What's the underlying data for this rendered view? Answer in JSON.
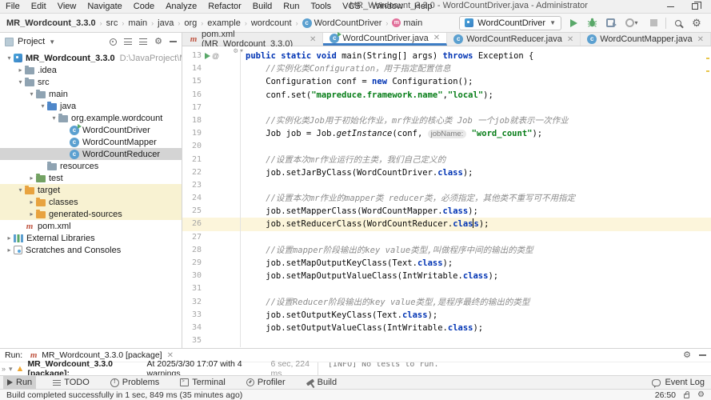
{
  "window": {
    "title": "MR_Wordcount_3.3.0 - WordCountDriver.java - Administrator"
  },
  "menu": {
    "items": [
      "File",
      "Edit",
      "View",
      "Navigate",
      "Code",
      "Analyze",
      "Refactor",
      "Build",
      "Run",
      "Tools",
      "VCS",
      "Window",
      "Help"
    ]
  },
  "navbar": {
    "breadcrumbs": [
      {
        "label": "MR_Wordcount_3.3.0",
        "bold": true
      },
      {
        "label": "src"
      },
      {
        "label": "main"
      },
      {
        "label": "java"
      },
      {
        "label": "org"
      },
      {
        "label": "example"
      },
      {
        "label": "wordcount"
      },
      {
        "label": "WordCountDriver",
        "icon": "class"
      },
      {
        "label": "main",
        "icon": "method"
      }
    ],
    "run_config": "WordCountDriver"
  },
  "project": {
    "header": "Project",
    "tree": [
      {
        "label": "MR_Wordcount_3.3.0",
        "path": "D:\\JavaProject\\MR_Worc",
        "level": 0,
        "chevron": "down",
        "icon": "project",
        "bold": true
      },
      {
        "label": ".idea",
        "level": 1,
        "chevron": "right",
        "icon": "folder"
      },
      {
        "label": "src",
        "level": 1,
        "chevron": "down",
        "icon": "folder"
      },
      {
        "label": "main",
        "level": 2,
        "chevron": "down",
        "icon": "folder"
      },
      {
        "label": "java",
        "level": 3,
        "chevron": "down",
        "icon": "folder-src"
      },
      {
        "label": "org.example.wordcount",
        "level": 4,
        "chevron": "down",
        "icon": "package"
      },
      {
        "label": "WordCountDriver",
        "level": 5,
        "chevron": "none",
        "icon": "class-run"
      },
      {
        "label": "WordCountMapper",
        "level": 5,
        "chevron": "none",
        "icon": "class"
      },
      {
        "label": "WordCountReducer",
        "level": 5,
        "chevron": "none",
        "icon": "class",
        "selected": true
      },
      {
        "label": "resources",
        "level": 3,
        "chevron": "none",
        "icon": "folder"
      },
      {
        "label": "test",
        "level": 2,
        "chevron": "right",
        "icon": "folder-test"
      },
      {
        "label": "target",
        "level": 1,
        "chevron": "down",
        "icon": "folder-excluded",
        "highlight": true
      },
      {
        "label": "classes",
        "level": 2,
        "chevron": "right",
        "icon": "folder-excluded",
        "highlight": true
      },
      {
        "label": "generated-sources",
        "level": 2,
        "chevron": "right",
        "icon": "folder-excluded",
        "highlight": true
      },
      {
        "label": "pom.xml",
        "level": 1,
        "chevron": "none",
        "icon": "maven"
      },
      {
        "label": "External Libraries",
        "level": 0,
        "chevron": "right",
        "icon": "libs"
      },
      {
        "label": "Scratches and Consoles",
        "level": 0,
        "chevron": "right",
        "icon": "scratches"
      }
    ]
  },
  "tabs": [
    {
      "label": "pom.xml (MR_Wordcount_3.3.0)",
      "icon": "maven"
    },
    {
      "label": "WordCountDriver.java",
      "icon": "class-run",
      "active": true
    },
    {
      "label": "WordCountReducer.java",
      "icon": "class"
    },
    {
      "label": "WordCountMapper.java",
      "icon": "class"
    }
  ],
  "editor": {
    "lines": [
      {
        "n": 13,
        "gutter": "run",
        "segs": [
          {
            "t": "public static void ",
            "c": "kw"
          },
          {
            "t": "main(String[] args) ",
            "c": "plain"
          },
          {
            "t": "throws ",
            "c": "kw"
          },
          {
            "t": "Exception {",
            "c": "plain"
          }
        ]
      },
      {
        "n": 14,
        "segs": [
          {
            "t": "    //实例化类Configuration，用于指定配置信息",
            "c": "com"
          }
        ]
      },
      {
        "n": 15,
        "segs": [
          {
            "t": "    Configuration conf = ",
            "c": "plain"
          },
          {
            "t": "new",
            "c": "kw"
          },
          {
            "t": " Configuration();",
            "c": "plain"
          }
        ]
      },
      {
        "n": 16,
        "segs": [
          {
            "t": "    conf.set(",
            "c": "plain"
          },
          {
            "t": "\"mapreduce.framework.name\"",
            "c": "str"
          },
          {
            "t": ",",
            "c": "plain"
          },
          {
            "t": "\"local\"",
            "c": "str"
          },
          {
            "t": ");",
            "c": "plain"
          }
        ]
      },
      {
        "n": 17,
        "segs": []
      },
      {
        "n": 18,
        "segs": [
          {
            "t": "    //实例化类Job用于初始化作业，mr作业的核心类 Job 一个job就表示一次作业",
            "c": "com"
          }
        ]
      },
      {
        "n": 19,
        "segs": [
          {
            "t": "    Job job = Job.",
            "c": "plain"
          },
          {
            "t": "getInstance",
            "c": "staticm"
          },
          {
            "t": "(conf, ",
            "c": "plain"
          },
          {
            "t": "jobName:",
            "c": "hint"
          },
          {
            "t": " ",
            "c": "plain"
          },
          {
            "t": "\"word_count\"",
            "c": "str"
          },
          {
            "t": ");",
            "c": "plain"
          }
        ]
      },
      {
        "n": 20,
        "segs": []
      },
      {
        "n": 21,
        "segs": [
          {
            "t": "    //设置本次mr作业运行的主类，我们自己定义的",
            "c": "com"
          }
        ]
      },
      {
        "n": 22,
        "segs": [
          {
            "t": "    job.setJarByClass(WordCountDriver.",
            "c": "plain"
          },
          {
            "t": "class",
            "c": "kw"
          },
          {
            "t": ");",
            "c": "plain"
          }
        ]
      },
      {
        "n": 23,
        "segs": []
      },
      {
        "n": 24,
        "segs": [
          {
            "t": "    //设置本次mr作业的mapper类 reducer类，必须指定，其他类不重写可不用指定",
            "c": "com"
          }
        ]
      },
      {
        "n": 25,
        "segs": [
          {
            "t": "    job.setMapperClass(WordCountMapper.",
            "c": "plain"
          },
          {
            "t": "class",
            "c": "kw"
          },
          {
            "t": ");",
            "c": "plain"
          }
        ]
      },
      {
        "n": 26,
        "current": true,
        "segs": [
          {
            "t": "    job.setReducerClass(WordCountReducer.",
            "c": "plain"
          },
          {
            "t": "clas",
            "c": "kw"
          },
          {
            "t": "",
            "c": "caret"
          },
          {
            "t": "s",
            "c": "kw"
          },
          {
            "t": ");",
            "c": "plain"
          }
        ]
      },
      {
        "n": 27,
        "segs": []
      },
      {
        "n": 28,
        "segs": [
          {
            "t": "    //设置mapper阶段输出的key value类型,叫做程序中间的输出的类型",
            "c": "com"
          }
        ]
      },
      {
        "n": 29,
        "segs": [
          {
            "t": "    job.setMapOutputKeyClass(Text.",
            "c": "plain"
          },
          {
            "t": "class",
            "c": "kw"
          },
          {
            "t": ");",
            "c": "plain"
          }
        ]
      },
      {
        "n": 30,
        "segs": [
          {
            "t": "    job.setMapOutputValueClass(IntWritable.",
            "c": "plain"
          },
          {
            "t": "class",
            "c": "kw"
          },
          {
            "t": ");",
            "c": "plain"
          }
        ]
      },
      {
        "n": 31,
        "segs": []
      },
      {
        "n": 32,
        "segs": [
          {
            "t": "    //设置Reducer阶段输出的key value类型,是程序最终的输出的类型",
            "c": "com"
          }
        ]
      },
      {
        "n": 33,
        "segs": [
          {
            "t": "    job.setOutputKeyClass(Text.",
            "c": "plain"
          },
          {
            "t": "class",
            "c": "kw"
          },
          {
            "t": ");",
            "c": "plain"
          }
        ]
      },
      {
        "n": 34,
        "segs": [
          {
            "t": "    job.setOutputValueClass(IntWritable.",
            "c": "plain"
          },
          {
            "t": "class",
            "c": "kw"
          },
          {
            "t": ");",
            "c": "plain"
          }
        ]
      },
      {
        "n": 35,
        "segs": []
      }
    ]
  },
  "run_panel": {
    "run_label": "Run:",
    "tab_label": "MR_Wordcount_3.3.0 [package]",
    "status_bold": "MR_Wordcount_3.3.0 [package]:",
    "status_text": "At 2025/3/30 17:07 with 4 warnings",
    "duration": "6 sec, 224 ms",
    "console_line": "[INFO] No tests to run."
  },
  "toolbar_bottom": {
    "items": [
      {
        "label": "Run",
        "icon": "run",
        "active": true
      },
      {
        "label": "TODO",
        "icon": "todo"
      },
      {
        "label": "Problems",
        "icon": "problems"
      },
      {
        "label": "Terminal",
        "icon": "terminal"
      },
      {
        "label": "Profiler",
        "icon": "profiler"
      },
      {
        "label": "Build",
        "icon": "build"
      }
    ],
    "event_log": "Event Log"
  },
  "statusbar": {
    "message": "Build completed successfully in 1 sec, 849 ms (35 minutes ago)",
    "position": "26:50"
  },
  "colors": {
    "accent": "#3d7dc4",
    "run_green": "#59a869",
    "warning": "#f0a732",
    "keyword": "#0033b3",
    "string": "#067d17",
    "comment": "#8c8c8c",
    "selection": "#d4d4d4",
    "excluded_bg": "#f8f2d2",
    "current_line": "#fcf5db",
    "maven_red": "#bf5340"
  }
}
